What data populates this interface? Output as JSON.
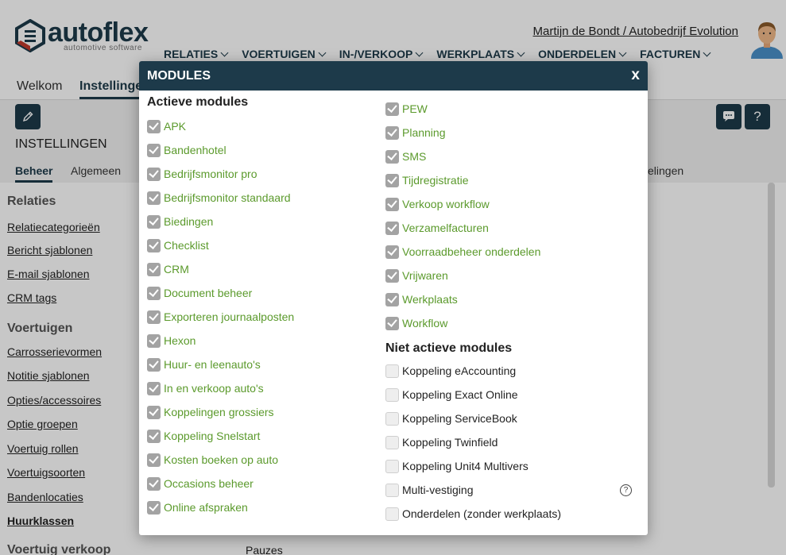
{
  "brand": {
    "name": "autoflex",
    "tagline": "automotive software"
  },
  "user": {
    "name": "Martijn de Bondt / Autobedrijf Evolution"
  },
  "main_nav": [
    "RELATIES",
    "VOERTUIGEN",
    "IN-/VERKOOP",
    "WERKPLAATS",
    "ONDERDELEN",
    "FACTUREN"
  ],
  "tabs": [
    "Welkom",
    "Instellingen"
  ],
  "page": {
    "title": "INSTELLINGEN",
    "subtabs": [
      "Beheer",
      "Algemeen",
      "elingen"
    ],
    "help_label": "?"
  },
  "sidebar": {
    "sections": [
      {
        "heading": "Relaties",
        "links": [
          "Relatiecategorieën",
          "Bericht sjablonen",
          "E-mail sjablonen",
          "CRM tags"
        ]
      },
      {
        "heading": "Voertuigen",
        "links": [
          "Carrosserievormen",
          "Notitie sjablonen",
          "Opties/accessoires",
          "Optie groepen",
          "Voertuig rollen",
          "Voertuigsoorten",
          "Bandenlocaties",
          "Huurklassen"
        ]
      },
      {
        "heading": "Voertuig verkoop",
        "links": []
      }
    ],
    "right_partial": "Pauzes"
  },
  "modal": {
    "title": "MODULES",
    "close_label": "x",
    "active_title": "Actieve modules",
    "inactive_title": "Niet actieve modules",
    "active_modules": [
      "APK",
      "Bandenhotel",
      "Bedrijfsmonitor pro",
      "Bedrijfsmonitor standaard",
      "Biedingen",
      "Checklist",
      "CRM",
      "Document beheer",
      "Exporteren journaalposten",
      "Hexon",
      "Huur- en leenauto's",
      "In en verkoop auto's",
      "Koppelingen grossiers",
      "Koppeling Snelstart",
      "Kosten boeken op auto",
      "Occasions beheer",
      "Online afspraken",
      "PEW",
      "Planning",
      "SMS",
      "Tijdregistratie",
      "Verkoop workflow",
      "Verzamelfacturen",
      "Voorraadbeheer onderdelen",
      "Vrijwaren",
      "Werkplaats",
      "Workflow"
    ],
    "inactive_modules": [
      "Koppeling eAccounting",
      "Koppeling Exact Online",
      "Koppeling ServiceBook",
      "Koppeling Twinfield",
      "Koppeling Unit4 Multivers",
      "Multi-vestiging",
      "Onderdelen (zonder werkplaats)"
    ],
    "info_icon_label": "?"
  },
  "colors": {
    "primary": "#1d3a4a",
    "active_module": "#5b9a2c",
    "checkbox_checked": "#a3a3a3"
  }
}
